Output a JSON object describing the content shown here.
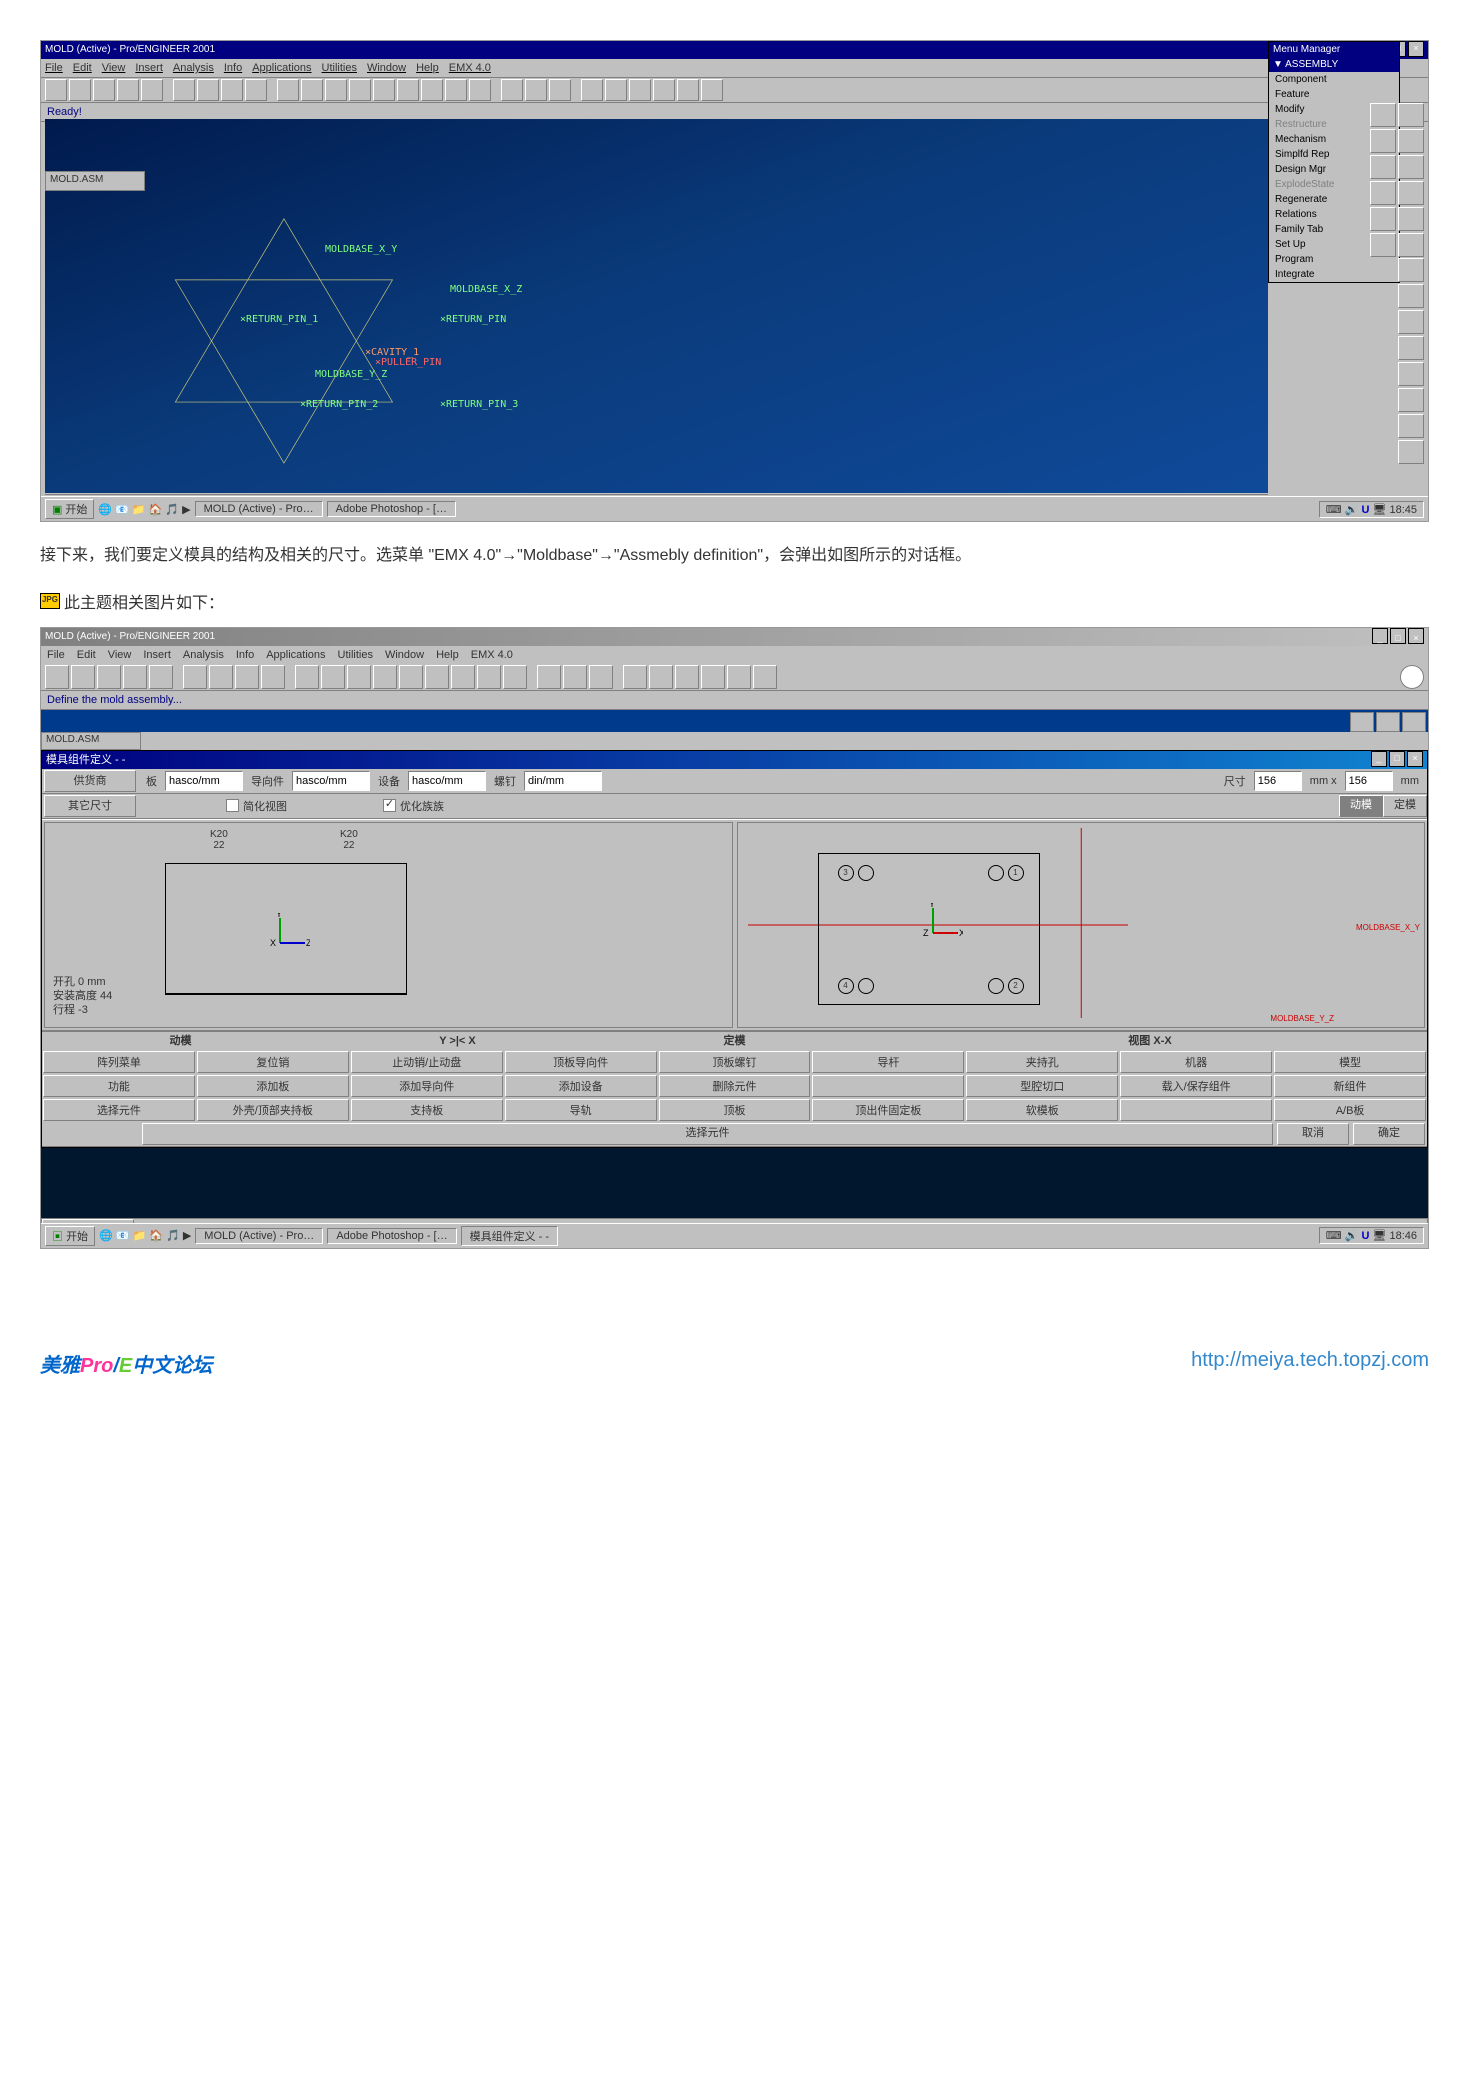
{
  "s1": {
    "title": "MOLD (Active) - Pro/ENGINEER 2001",
    "winbtns": [
      "_",
      "□",
      "×"
    ],
    "menus": [
      "File",
      "Edit",
      "View",
      "Insert",
      "Analysis",
      "Info",
      "Applications",
      "Utilities",
      "Window",
      "Help",
      "EMX 4.0"
    ],
    "status": "Ready!",
    "tab": "MOLD.ASM",
    "mm_header": "Menu Manager",
    "mm_active": "▼ ASSEMBLY",
    "mm_items": [
      "Component",
      "Feature",
      "Modify",
      "Restructure",
      "Mechanism",
      "Simplfd Rep",
      "Design Mgr",
      "ExplodeState",
      "Regenerate",
      "Relations",
      "Family Tab",
      "Set Up",
      "Program",
      "Integrate"
    ],
    "mm_disabled": [
      3,
      7
    ],
    "labels": {
      "mbxy": "MOLDBASE_X_Y",
      "mbxz": "MOLDBASE_X_Z",
      "mbyz": "MOLDBASE_Y_Z",
      "rp1": "×RETURN_PIN_1",
      "rp": "×RETURN_PIN",
      "rp2": "×RETURN_PIN_2",
      "rp3": "×RETURN_PIN_3",
      "cav": "×CAVITY_1",
      "pul": "×PULLER_PIN"
    },
    "taskbar": {
      "start": "开始",
      "tasks": [
        "MOLD (Active) - Pro…",
        "Adobe Photoshop - […"
      ],
      "clock": "18:45"
    }
  },
  "para": "接下来，我们要定义模具的结构及相关的尺寸。选菜单 \"EMX 4.0\"→\"Moldbase\"→\"Assmebly definition\"，会弹出如图所示的对话框。",
  "imgnote": "此主题相关图片如下：",
  "s2": {
    "title": "MOLD (Active) - Pro/ENGINEER 2001",
    "menus": [
      "File",
      "Edit",
      "View",
      "Insert",
      "Analysis",
      "Info",
      "Applications",
      "Utilities",
      "Window",
      "Help",
      "EMX 4.0"
    ],
    "status": "Define the mold assembly...",
    "tab": "MOLD.ASM",
    "dlg_title": "模具组件定义 - -",
    "row1": {
      "l1": "供货商",
      "l2": "板",
      "v1": "hasco/mm",
      "l3": "导向件",
      "v2": "hasco/mm",
      "l4": "设备",
      "v3": "hasco/mm",
      "l5": "螺钉",
      "v4": "din/mm",
      "l6": "尺寸",
      "v5": "156",
      "mm_x": "mm x",
      "v6": "156",
      "mm": "mm"
    },
    "row2": {
      "l1": "其它尺寸",
      "cb1": "简化视图",
      "cb2": "优化族族",
      "b1": "动模",
      "b2": "定模"
    },
    "k20": "K20\n22",
    "side_labels": {
      "k1": "开孔 0 mm",
      "k2": "安装高度 44",
      "k3": "行程 -3"
    },
    "axis_mb_xy": "MOLDBASE_X_Y",
    "axis_mb_yz": "MOLDBASE_Y_Z",
    "cap": {
      "c1": "动模",
      "c2": "Y >|< X",
      "c3": "定模",
      "c4": "视图 X-X"
    },
    "row_a": [
      "阵列菜单",
      "复位销",
      "止动销/止动盘",
      "顶板导向件",
      "顶板螺钉",
      "导杆",
      "夹持孔",
      "机器",
      "模型"
    ],
    "row_b": [
      "功能",
      "添加板",
      "添加导向件",
      "添加设备",
      "删除元件",
      "",
      "型腔切口",
      "载入/保存组件",
      "新组件"
    ],
    "row_c": [
      "选择元件",
      "外壳/顶部夹持板",
      "支持板",
      "导轨",
      "顶板",
      "顶出件固定板",
      "软模板",
      "",
      "A/B板"
    ],
    "bottom": {
      "sel": "选择元件",
      "cancel": "取消",
      "ok": "确定"
    },
    "taskbar": {
      "start": "开始",
      "tasks": [
        "MOLD (Active) - Pro…",
        "Adobe Photoshop - […",
        "模具组件定义 - -"
      ],
      "clock": "18:46"
    },
    "circles": [
      "3",
      "1",
      "4",
      "2"
    ]
  },
  "footer": {
    "brand_pre": "美雅",
    "brand_p": "Pro",
    "brand_slash": "/",
    "brand_e": "E",
    "brand_post": "中文论坛",
    "url": "http://meiya.tech.topzj.com"
  }
}
